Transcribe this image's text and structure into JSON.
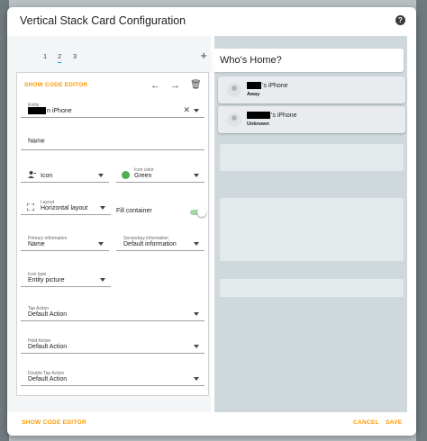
{
  "dialog": {
    "title": "Vertical Stack Card Configuration",
    "help_icon": "question-circle-icon"
  },
  "tabs": [
    {
      "label": "1"
    },
    {
      "label": "2",
      "active": true
    },
    {
      "label": "3"
    }
  ],
  "editor": {
    "show_code_editor": "SHOW CODE EDITOR",
    "entity": {
      "label": "Entity",
      "value_suffix": "n iPhone"
    },
    "name": {
      "label": "Name"
    },
    "icon": {
      "label": "Icon"
    },
    "icon_color": {
      "label": "Icon color",
      "value": "Green",
      "color": "#4caf50"
    },
    "layout": {
      "label": "Layout",
      "value": "Horizontal layout"
    },
    "fill_container": {
      "label": "Fill container",
      "checked": true
    },
    "primary_information": {
      "label": "Primary information",
      "value": "Name"
    },
    "secondary_information": {
      "label": "Secondary information",
      "value": "Default information"
    },
    "icon_type": {
      "label": "Icon type",
      "value": "Entity picture"
    },
    "tap_action": {
      "label": "Tap Action",
      "value": "Default Action"
    },
    "hold_action": {
      "label": "Hold Action",
      "value": "Default Action"
    },
    "double_tap_action": {
      "label": "Double Tap Action",
      "value": "Default Action"
    }
  },
  "footer": {
    "show_code_editor": "SHOW CODE EDITOR",
    "cancel": "CANCEL",
    "save": "SAVE"
  },
  "preview": {
    "title": "Who's Home?",
    "people": [
      {
        "name_suffix": "'s iPhone",
        "state": "Away"
      },
      {
        "name_suffix": "'s iPhone",
        "state": "Unknown"
      }
    ]
  },
  "colors": {
    "accent": "#ff9800",
    "switch_on": "#a5d6a7",
    "tab_indicator": "#03a9f4"
  }
}
